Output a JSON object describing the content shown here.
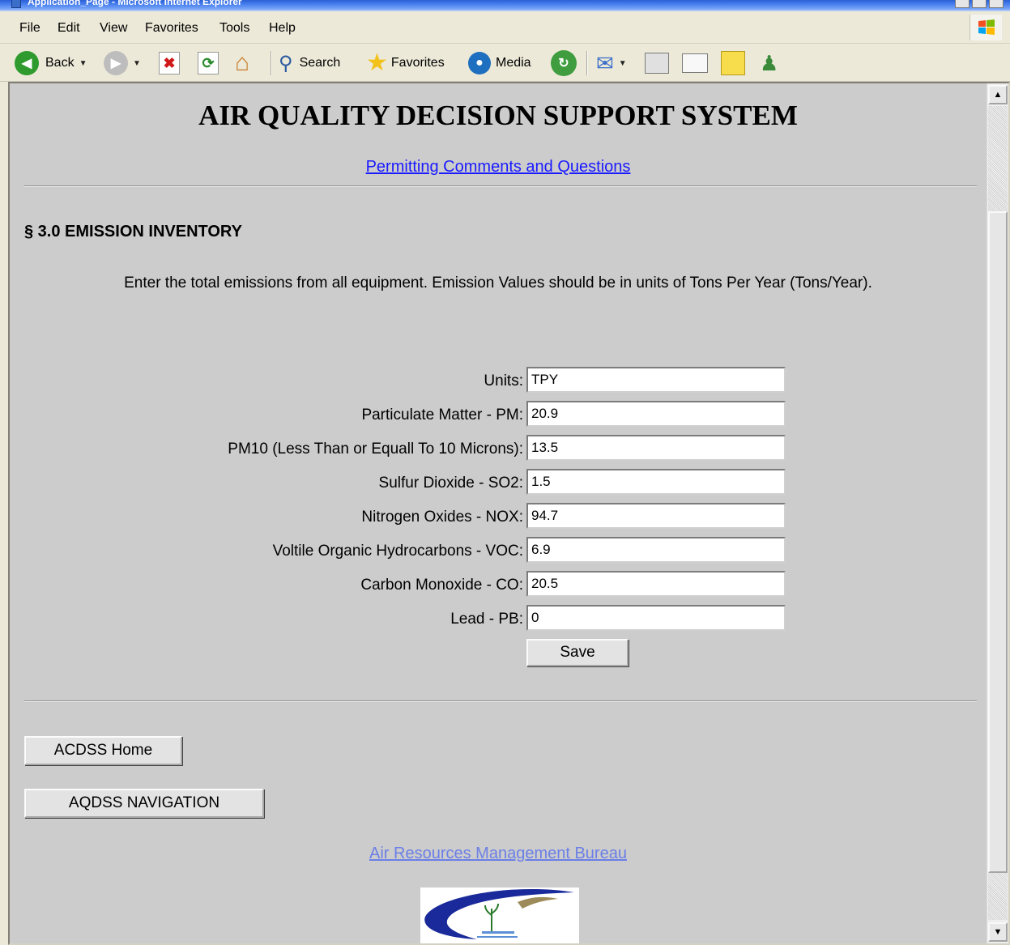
{
  "window": {
    "title": "Application_Page - Microsoft Internet Explorer"
  },
  "menu": [
    "File",
    "Edit",
    "View",
    "Favorites",
    "Tools",
    "Help"
  ],
  "toolbar": {
    "back": "Back",
    "search": "Search",
    "favorites": "Favorites",
    "media": "Media"
  },
  "page": {
    "title": "AIR QUALITY DECISION SUPPORT SYSTEM",
    "permit_link": "Permitting Comments and Questions",
    "section_heading": "§ 3.0 EMISSION INVENTORY",
    "instructions": "Enter the total emissions from all equipment. Emission Values should be in units of Tons Per Year (Tons/Year).",
    "form": [
      {
        "label": "Units:",
        "value": "TPY"
      },
      {
        "label": "Particulate Matter - PM:",
        "value": "20.9"
      },
      {
        "label": "PM10 (Less Than or Equall To 10 Microns):",
        "value": "13.5"
      },
      {
        "label": "Sulfur Dioxide - SO2:",
        "value": "1.5"
      },
      {
        "label": "Nitrogen Oxides - NOX:",
        "value": "94.7"
      },
      {
        "label": "Voltile Organic Hydrocarbons - VOC:",
        "value": "6.9"
      },
      {
        "label": "Carbon Monoxide - CO:",
        "value": "20.5"
      },
      {
        "label": "Lead - PB:",
        "value": "0"
      }
    ],
    "save_label": "Save",
    "home_button": "ACDSS Home",
    "nav_button": "AQDSS NAVIGATION",
    "footer_link": "Air Resources Management Bureau"
  },
  "colors": {
    "page_bg": "#cccccc",
    "link": "#1a1aff",
    "footer_link": "#6b7fe6"
  }
}
